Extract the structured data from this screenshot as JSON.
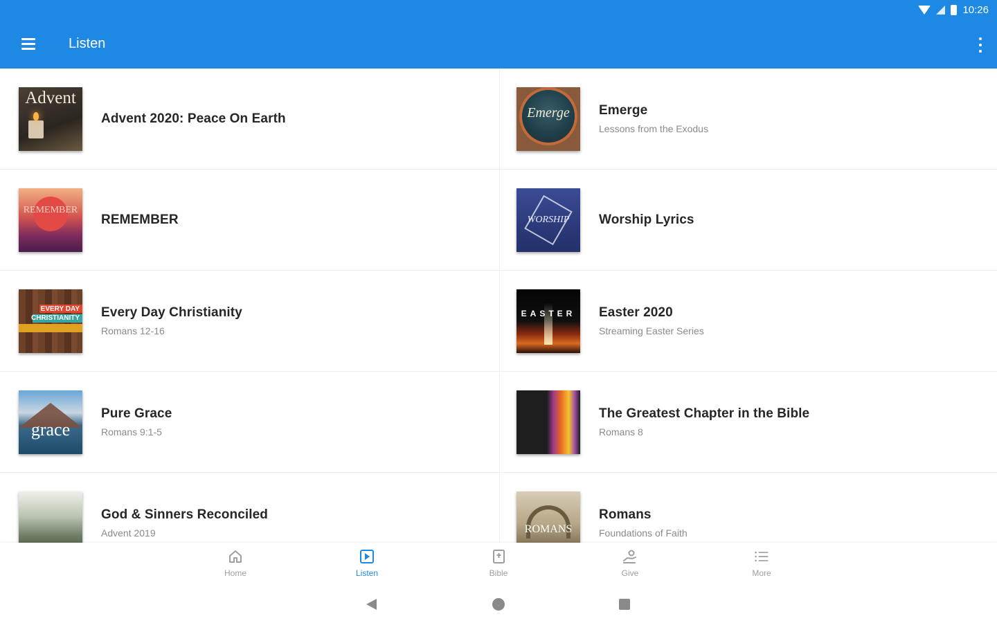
{
  "status": {
    "time": "10:26"
  },
  "appbar": {
    "title": "Listen"
  },
  "series": [
    {
      "title": "Advent 2020: Peace On Earth",
      "subtitle": "",
      "art": "advent",
      "art_text": "Advent"
    },
    {
      "title": "Emerge",
      "subtitle": "Lessons from the Exodus",
      "art": "emerge",
      "art_text": "Emerge"
    },
    {
      "title": "REMEMBER",
      "subtitle": "",
      "art": "remember",
      "art_text": "REMEMBER"
    },
    {
      "title": "Worship Lyrics",
      "subtitle": "",
      "art": "worship",
      "art_text": "WORSHIP"
    },
    {
      "title": "Every Day Christianity",
      "subtitle": "Romans 12-16",
      "art": "everyday",
      "art_text": "EVERY DAY CHRISTIANITY"
    },
    {
      "title": "Easter 2020",
      "subtitle": "Streaming Easter Series",
      "art": "easter",
      "art_text": "EASTER"
    },
    {
      "title": "Pure Grace",
      "subtitle": "Romans 9:1-5",
      "art": "grace",
      "art_text": "grace"
    },
    {
      "title": "The Greatest Chapter in the Bible",
      "subtitle": "Romans 8",
      "art": "greatest",
      "art_text": ""
    },
    {
      "title": "God & Sinners Reconciled",
      "subtitle": "Advent 2019",
      "art": "god",
      "art_text": ""
    },
    {
      "title": "Romans",
      "subtitle": "Foundations of Faith",
      "art": "romans",
      "art_text": "ROMANS"
    }
  ],
  "bottomnav": {
    "items": [
      {
        "label": "Home",
        "icon": "home-icon"
      },
      {
        "label": "Listen",
        "icon": "play-box-icon",
        "active": true
      },
      {
        "label": "Bible",
        "icon": "bible-icon"
      },
      {
        "label": "Give",
        "icon": "give-icon"
      },
      {
        "label": "More",
        "icon": "list-icon"
      }
    ]
  },
  "colors": {
    "primary": "#1E88E5",
    "inactive": "#9e9e9e"
  }
}
